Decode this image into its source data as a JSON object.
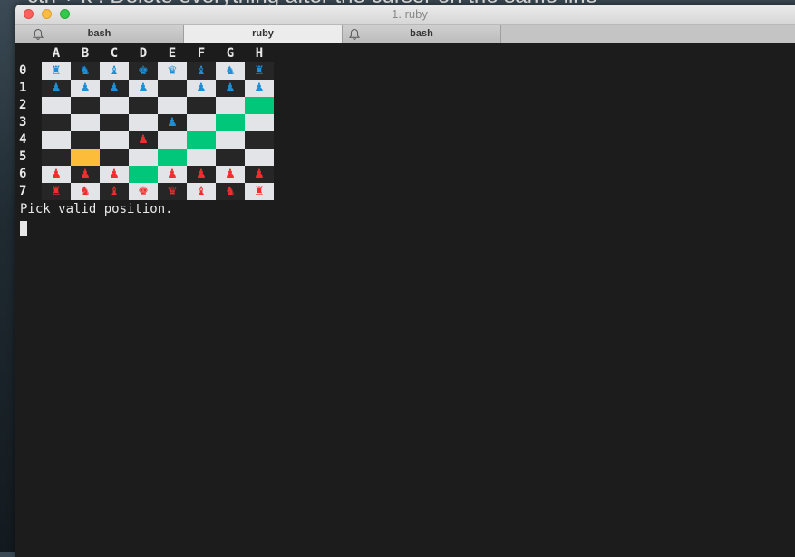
{
  "background_text": "ctrl + k : Delete everything after the cursor on the same line",
  "window": {
    "title": "1. ruby"
  },
  "tabs": [
    {
      "label": "bash",
      "active": false,
      "bell": true
    },
    {
      "label": "ruby",
      "active": true,
      "bell": false
    },
    {
      "label": "bash",
      "active": false,
      "bell": true
    }
  ],
  "columns": [
    "A",
    "B",
    "C",
    "D",
    "E",
    "F",
    "G",
    "H"
  ],
  "rows": [
    "0",
    "1",
    "2",
    "3",
    "4",
    "5",
    "6",
    "7"
  ],
  "colors": {
    "light_square": "#e2e4e8",
    "dark_square": "#262626",
    "highlight_green": "#00c77a",
    "selected_yellow": "#fdbd3a",
    "blue_piece": "#1d8fd6",
    "red_piece": "#f02e2e"
  },
  "board": [
    [
      {
        "piece": "♜",
        "color": "blue"
      },
      {
        "piece": "♞",
        "color": "blue"
      },
      {
        "piece": "♝",
        "color": "blue"
      },
      {
        "piece": "♚",
        "color": "blue"
      },
      {
        "piece": "♛",
        "color": "blue"
      },
      {
        "piece": "♝",
        "color": "blue"
      },
      {
        "piece": "♞",
        "color": "blue"
      },
      {
        "piece": "♜",
        "color": "blue"
      }
    ],
    [
      {
        "piece": "♟",
        "color": "blue"
      },
      {
        "piece": "♟",
        "color": "blue"
      },
      {
        "piece": "♟",
        "color": "blue"
      },
      {
        "piece": "♟",
        "color": "blue"
      },
      {
        "piece": "",
        "color": ""
      },
      {
        "piece": "♟",
        "color": "blue"
      },
      {
        "piece": "♟",
        "color": "blue"
      },
      {
        "piece": "♟",
        "color": "blue"
      }
    ],
    [
      {
        "piece": "",
        "color": ""
      },
      {
        "piece": "",
        "color": ""
      },
      {
        "piece": "",
        "color": ""
      },
      {
        "piece": "",
        "color": ""
      },
      {
        "piece": "",
        "color": ""
      },
      {
        "piece": "",
        "color": ""
      },
      {
        "piece": "",
        "color": ""
      },
      {
        "piece": "",
        "color": "",
        "highlight": "green"
      }
    ],
    [
      {
        "piece": "",
        "color": ""
      },
      {
        "piece": "",
        "color": ""
      },
      {
        "piece": "",
        "color": ""
      },
      {
        "piece": "",
        "color": ""
      },
      {
        "piece": "♟",
        "color": "blue"
      },
      {
        "piece": "",
        "color": ""
      },
      {
        "piece": "",
        "color": "",
        "highlight": "green"
      },
      {
        "piece": "",
        "color": ""
      }
    ],
    [
      {
        "piece": "",
        "color": ""
      },
      {
        "piece": "",
        "color": ""
      },
      {
        "piece": "",
        "color": ""
      },
      {
        "piece": "♟",
        "color": "red"
      },
      {
        "piece": "",
        "color": ""
      },
      {
        "piece": "",
        "color": "",
        "highlight": "green"
      },
      {
        "piece": "",
        "color": ""
      },
      {
        "piece": "",
        "color": ""
      }
    ],
    [
      {
        "piece": "",
        "color": ""
      },
      {
        "piece": "",
        "color": "",
        "highlight": "yellow"
      },
      {
        "piece": "",
        "color": ""
      },
      {
        "piece": "",
        "color": ""
      },
      {
        "piece": "",
        "color": "",
        "highlight": "green"
      },
      {
        "piece": "",
        "color": ""
      },
      {
        "piece": "",
        "color": ""
      },
      {
        "piece": "",
        "color": ""
      }
    ],
    [
      {
        "piece": "♟",
        "color": "red"
      },
      {
        "piece": "♟",
        "color": "red"
      },
      {
        "piece": "♟",
        "color": "red"
      },
      {
        "piece": "",
        "color": "",
        "highlight": "green"
      },
      {
        "piece": "♟",
        "color": "red"
      },
      {
        "piece": "♟",
        "color": "red"
      },
      {
        "piece": "♟",
        "color": "red"
      },
      {
        "piece": "♟",
        "color": "red"
      }
    ],
    [
      {
        "piece": "♜",
        "color": "red"
      },
      {
        "piece": "♞",
        "color": "red"
      },
      {
        "piece": "♝",
        "color": "red"
      },
      {
        "piece": "♚",
        "color": "red"
      },
      {
        "piece": "♛",
        "color": "red"
      },
      {
        "piece": "♝",
        "color": "red"
      },
      {
        "piece": "♞",
        "color": "red"
      },
      {
        "piece": "♜",
        "color": "red"
      }
    ]
  ],
  "prompt": "Pick valid position."
}
